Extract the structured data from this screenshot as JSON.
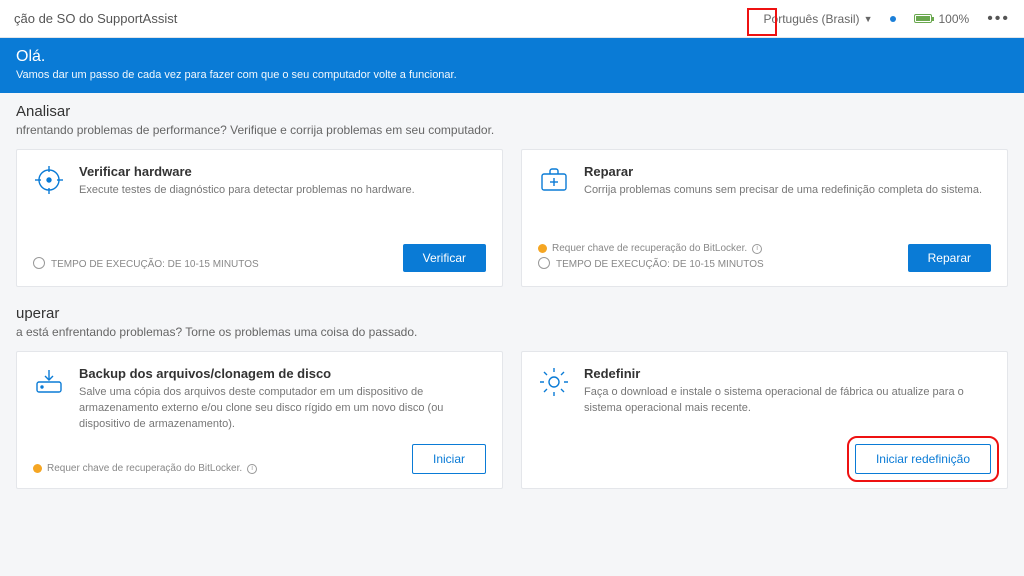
{
  "topbar": {
    "title": "ção de SO do SupportAssist",
    "language": "Português (Brasil)",
    "battery": "100%"
  },
  "hero": {
    "greeting": "Olá.",
    "sub": "Vamos dar um passo de cada vez para fazer com que o seu computador volte a funcionar."
  },
  "section_analyze": {
    "title": "Analisar",
    "sub": "nfrentando problemas de performance? Verifique e corrija problemas em seu computador."
  },
  "card_verify": {
    "title": "Verificar hardware",
    "desc": "Execute testes de diagnóstico para detectar problemas no hardware.",
    "time": "TEMPO DE EXECUÇÃO: DE 10-15 MINUTOS",
    "btn": "Verificar"
  },
  "card_repair": {
    "title": "Reparar",
    "desc": "Corrija problemas comuns sem precisar de uma redefinição completa do sistema.",
    "bitlocker": "Requer chave de recuperação do BitLocker.",
    "time": "TEMPO DE EXECUÇÃO: DE 10-15 MINUTOS",
    "btn": "Reparar"
  },
  "section_recover": {
    "title": "uperar",
    "sub": "a está enfrentando problemas? Torne os problemas uma coisa do passado."
  },
  "card_backup": {
    "title": "Backup dos arquivos/clonagem de disco",
    "desc": "Salve uma cópia dos arquivos deste computador em um dispositivo de armazenamento externo e/ou clone seu disco rígido em um novo disco (ou dispositivo de armazenamento).",
    "bitlocker": "Requer chave de recuperação do BitLocker.",
    "btn": "Iniciar"
  },
  "card_reset": {
    "title": "Redefinir",
    "desc": "Faça o download e instale o sistema operacional de fábrica ou atualize para o sistema operacional mais recente.",
    "btn": "Iniciar redefinição"
  }
}
